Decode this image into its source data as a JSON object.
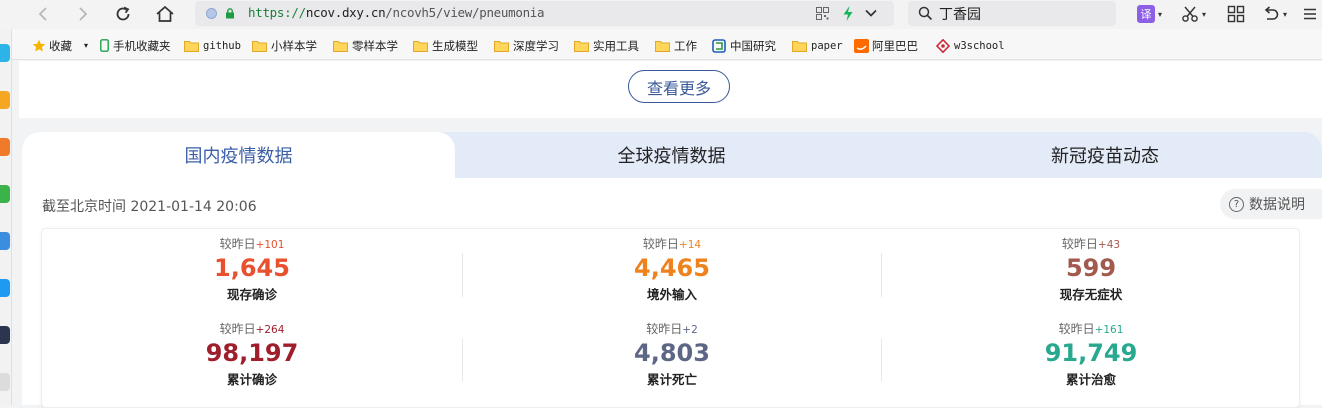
{
  "browser": {
    "url": {
      "scheme": "https://",
      "host": "ncov.dxy.cn",
      "path": "/ncovh5/view/pneumonia"
    },
    "search_query": "丁香园",
    "translate_label": "译"
  },
  "bookmarks": [
    {
      "label": "收藏",
      "icon": "star-icon"
    },
    {
      "label": "手机收藏夹",
      "icon": "phone-icon"
    },
    {
      "label": "github",
      "icon": "folder-icon"
    },
    {
      "label": "小样本学",
      "icon": "folder-icon"
    },
    {
      "label": "零样本学",
      "icon": "folder-icon"
    },
    {
      "label": "生成模型",
      "icon": "folder-icon"
    },
    {
      "label": "深度学习",
      "icon": "folder-icon"
    },
    {
      "label": "实用工具",
      "icon": "folder-icon"
    },
    {
      "label": "工作",
      "icon": "folder-icon"
    },
    {
      "label": "中国研究",
      "icon": "cnki-icon"
    },
    {
      "label": "paper",
      "icon": "folder-icon"
    },
    {
      "label": "阿里巴巴",
      "icon": "alibaba-icon"
    },
    {
      "label": "w3school",
      "icon": "w3school-icon"
    }
  ],
  "page": {
    "more_button": "查看更多",
    "tabs": [
      {
        "label": "国内疫情数据",
        "active": true
      },
      {
        "label": "全球疫情数据",
        "active": false
      },
      {
        "label": "新冠疫苗动态",
        "active": false
      }
    ],
    "timestamp": "截至北京时间 2021-01-14 20:06",
    "explain_label": "数据说明",
    "compare_prefix": "较昨日",
    "stats": [
      {
        "label": "现存确诊",
        "value": "1,645",
        "delta": "+101",
        "color": "#e8502e",
        "delta_color": "#e8502e"
      },
      {
        "label": "境外输入",
        "value": "4,465",
        "delta": "+14",
        "color": "#f0821e",
        "delta_color": "#f0821e"
      },
      {
        "label": "现存无症状",
        "value": "599",
        "delta": "+43",
        "color": "#a25a4e",
        "delta_color": "#a25a4e"
      },
      {
        "label": "累计确诊",
        "value": "98,197",
        "delta": "+264",
        "color": "#9e1e2c",
        "delta_color": "#9e1e2c"
      },
      {
        "label": "累计死亡",
        "value": "4,803",
        "delta": "+2",
        "color": "#5d6785",
        "delta_color": "#5d6785"
      },
      {
        "label": "累计治愈",
        "value": "91,749",
        "delta": "+161",
        "color": "#27a88f",
        "delta_color": "#27a88f"
      }
    ]
  }
}
